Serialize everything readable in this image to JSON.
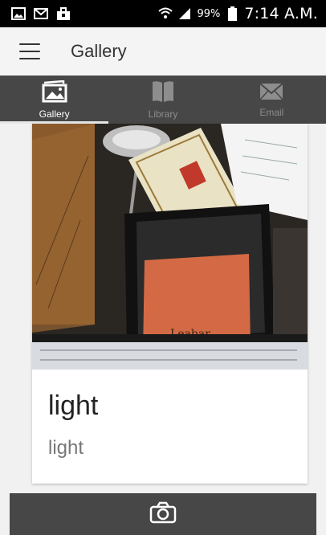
{
  "status_bar": {
    "left_icons": [
      "gallery-icon",
      "gmail-icon",
      "briefcase-icon"
    ],
    "battery_text": "99%",
    "time": "7:14 A.M."
  },
  "app_bar": {
    "title": "Gallery",
    "menu_icon": "hamburger-menu-icon"
  },
  "tabs": [
    {
      "label": "Gallery",
      "icon": "gallery-icon",
      "active": true
    },
    {
      "label": "Library",
      "icon": "book-icon",
      "active": false
    },
    {
      "label": "Email",
      "icon": "envelope-icon",
      "active": false
    }
  ],
  "card": {
    "title": "light",
    "subtitle": "light",
    "photo_text": "Leabar"
  },
  "bottom_bar": {
    "icon": "camera-icon"
  },
  "colors": {
    "status_bar": "#000000",
    "app_bar": "#f4f4f4",
    "tab_bar": "#474747",
    "tab_active_text": "#ffffff",
    "tab_inactive_text": "#8d8d8d",
    "card_bg": "#ffffff"
  }
}
